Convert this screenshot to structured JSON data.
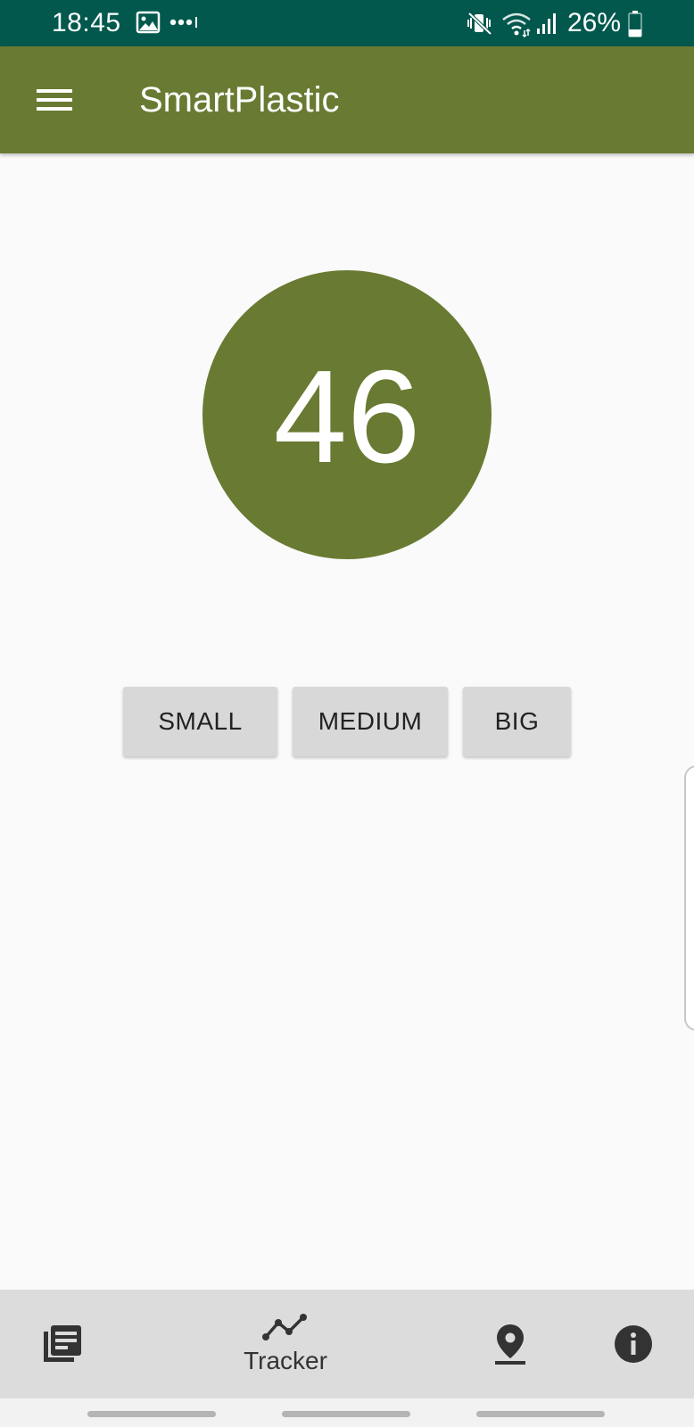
{
  "status_bar": {
    "time": "18:45",
    "battery": "26%",
    "icons": [
      "gallery-icon",
      "more-dots-icon",
      "vibrate-mute-icon",
      "wifi-icon",
      "signal-icon",
      "battery-icon"
    ]
  },
  "app_bar": {
    "title": "SmartPlastic",
    "menu_icon": "hamburger-menu-icon",
    "color": "#697a32"
  },
  "counter": {
    "value": "46",
    "color": "#697a32"
  },
  "size_buttons": {
    "small": "SMALL",
    "medium": "MEDIUM",
    "big": "BIG"
  },
  "bottom_nav": {
    "items": [
      {
        "icon": "news-icon",
        "label": ""
      },
      {
        "icon": "tracker-line-chart-icon",
        "label": "Tracker",
        "selected": true
      },
      {
        "icon": "map-pin-icon",
        "label": ""
      },
      {
        "icon": "info-icon",
        "label": ""
      }
    ]
  },
  "colors": {
    "status_bar": "#02584d",
    "primary": "#697a32",
    "background": "#fafafa",
    "button": "#d8d8d8",
    "bottom_nav": "#dcdcdc"
  }
}
